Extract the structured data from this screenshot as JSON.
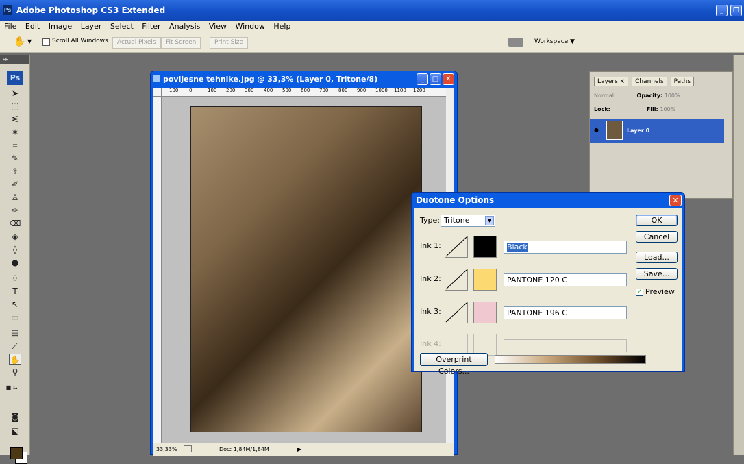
{
  "app": {
    "logo": "Ps",
    "title": "Adobe Photoshop CS3 Extended"
  },
  "menu": [
    "File",
    "Edit",
    "Image",
    "Layer",
    "Select",
    "Filter",
    "Analysis",
    "View",
    "Window",
    "Help"
  ],
  "options": {
    "scroll_all_windows": "Scroll All Windows",
    "actual_pixels": "Actual Pixels",
    "fit_screen": "Fit Screen",
    "print_size": "Print Size",
    "workspace": "Workspace ▼"
  },
  "tools": {
    "ps_logo": "Ps"
  },
  "document": {
    "title": "povijesne tehnike.jpg @ 33,3% (Layer 0, Tritone/8)",
    "ruler_ticks": [
      "100",
      "0",
      "100",
      "200",
      "300",
      "400",
      "500",
      "600",
      "700",
      "800",
      "900",
      "1000",
      "1100",
      "1200"
    ],
    "zoom": "33,33%",
    "doc_info": "Doc: 1,84M/1,84M"
  },
  "layers_panel": {
    "tabs": [
      "Layers ×",
      "Channels",
      "Paths"
    ],
    "blend_mode": "Normal",
    "opacity_label": "Opacity:",
    "opacity_value": "100%",
    "lock_label": "Lock:",
    "fill_label": "Fill:",
    "fill_value": "100%",
    "layer_name": "Layer 0"
  },
  "duotone": {
    "title": "Duotone Options",
    "type_label": "Type:",
    "type_value": "Tritone",
    "ink1_label": "Ink 1:",
    "ink1_name": "Black",
    "ink1_color": "#000000",
    "ink2_label": "Ink 2:",
    "ink2_name": "PANTONE 120 C",
    "ink2_color": "#fcd971",
    "ink3_label": "Ink 3:",
    "ink3_name": "PANTONE 196 C",
    "ink3_color": "#f0c8cf",
    "ink4_label": "Ink 4:",
    "ok": "OK",
    "cancel": "Cancel",
    "load": "Load...",
    "save": "Save...",
    "preview": "Preview",
    "overprint": "Overprint Colors..."
  }
}
